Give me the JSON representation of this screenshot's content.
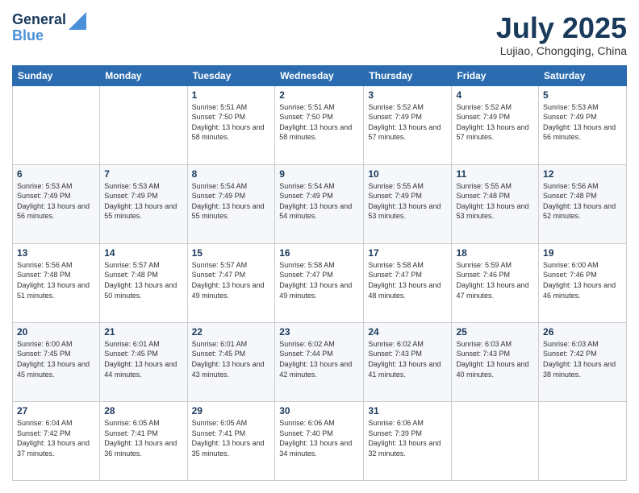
{
  "logo": {
    "general": "General",
    "blue": "Blue"
  },
  "title": {
    "month_year": "July 2025",
    "location": "Lujiao, Chongqing, China"
  },
  "calendar": {
    "headers": [
      "Sunday",
      "Monday",
      "Tuesday",
      "Wednesday",
      "Thursday",
      "Friday",
      "Saturday"
    ],
    "rows": [
      [
        {
          "day": "",
          "info": ""
        },
        {
          "day": "",
          "info": ""
        },
        {
          "day": "1",
          "info": "Sunrise: 5:51 AM\nSunset: 7:50 PM\nDaylight: 13 hours and 58 minutes."
        },
        {
          "day": "2",
          "info": "Sunrise: 5:51 AM\nSunset: 7:50 PM\nDaylight: 13 hours and 58 minutes."
        },
        {
          "day": "3",
          "info": "Sunrise: 5:52 AM\nSunset: 7:49 PM\nDaylight: 13 hours and 57 minutes."
        },
        {
          "day": "4",
          "info": "Sunrise: 5:52 AM\nSunset: 7:49 PM\nDaylight: 13 hours and 57 minutes."
        },
        {
          "day": "5",
          "info": "Sunrise: 5:53 AM\nSunset: 7:49 PM\nDaylight: 13 hours and 56 minutes."
        }
      ],
      [
        {
          "day": "6",
          "info": "Sunrise: 5:53 AM\nSunset: 7:49 PM\nDaylight: 13 hours and 56 minutes."
        },
        {
          "day": "7",
          "info": "Sunrise: 5:53 AM\nSunset: 7:49 PM\nDaylight: 13 hours and 55 minutes."
        },
        {
          "day": "8",
          "info": "Sunrise: 5:54 AM\nSunset: 7:49 PM\nDaylight: 13 hours and 55 minutes."
        },
        {
          "day": "9",
          "info": "Sunrise: 5:54 AM\nSunset: 7:49 PM\nDaylight: 13 hours and 54 minutes."
        },
        {
          "day": "10",
          "info": "Sunrise: 5:55 AM\nSunset: 7:49 PM\nDaylight: 13 hours and 53 minutes."
        },
        {
          "day": "11",
          "info": "Sunrise: 5:55 AM\nSunset: 7:48 PM\nDaylight: 13 hours and 53 minutes."
        },
        {
          "day": "12",
          "info": "Sunrise: 5:56 AM\nSunset: 7:48 PM\nDaylight: 13 hours and 52 minutes."
        }
      ],
      [
        {
          "day": "13",
          "info": "Sunrise: 5:56 AM\nSunset: 7:48 PM\nDaylight: 13 hours and 51 minutes."
        },
        {
          "day": "14",
          "info": "Sunrise: 5:57 AM\nSunset: 7:48 PM\nDaylight: 13 hours and 50 minutes."
        },
        {
          "day": "15",
          "info": "Sunrise: 5:57 AM\nSunset: 7:47 PM\nDaylight: 13 hours and 49 minutes."
        },
        {
          "day": "16",
          "info": "Sunrise: 5:58 AM\nSunset: 7:47 PM\nDaylight: 13 hours and 49 minutes."
        },
        {
          "day": "17",
          "info": "Sunrise: 5:58 AM\nSunset: 7:47 PM\nDaylight: 13 hours and 48 minutes."
        },
        {
          "day": "18",
          "info": "Sunrise: 5:59 AM\nSunset: 7:46 PM\nDaylight: 13 hours and 47 minutes."
        },
        {
          "day": "19",
          "info": "Sunrise: 6:00 AM\nSunset: 7:46 PM\nDaylight: 13 hours and 46 minutes."
        }
      ],
      [
        {
          "day": "20",
          "info": "Sunrise: 6:00 AM\nSunset: 7:45 PM\nDaylight: 13 hours and 45 minutes."
        },
        {
          "day": "21",
          "info": "Sunrise: 6:01 AM\nSunset: 7:45 PM\nDaylight: 13 hours and 44 minutes."
        },
        {
          "day": "22",
          "info": "Sunrise: 6:01 AM\nSunset: 7:45 PM\nDaylight: 13 hours and 43 minutes."
        },
        {
          "day": "23",
          "info": "Sunrise: 6:02 AM\nSunset: 7:44 PM\nDaylight: 13 hours and 42 minutes."
        },
        {
          "day": "24",
          "info": "Sunrise: 6:02 AM\nSunset: 7:43 PM\nDaylight: 13 hours and 41 minutes."
        },
        {
          "day": "25",
          "info": "Sunrise: 6:03 AM\nSunset: 7:43 PM\nDaylight: 13 hours and 40 minutes."
        },
        {
          "day": "26",
          "info": "Sunrise: 6:03 AM\nSunset: 7:42 PM\nDaylight: 13 hours and 38 minutes."
        }
      ],
      [
        {
          "day": "27",
          "info": "Sunrise: 6:04 AM\nSunset: 7:42 PM\nDaylight: 13 hours and 37 minutes."
        },
        {
          "day": "28",
          "info": "Sunrise: 6:05 AM\nSunset: 7:41 PM\nDaylight: 13 hours and 36 minutes."
        },
        {
          "day": "29",
          "info": "Sunrise: 6:05 AM\nSunset: 7:41 PM\nDaylight: 13 hours and 35 minutes."
        },
        {
          "day": "30",
          "info": "Sunrise: 6:06 AM\nSunset: 7:40 PM\nDaylight: 13 hours and 34 minutes."
        },
        {
          "day": "31",
          "info": "Sunrise: 6:06 AM\nSunset: 7:39 PM\nDaylight: 13 hours and 32 minutes."
        },
        {
          "day": "",
          "info": ""
        },
        {
          "day": "",
          "info": ""
        }
      ]
    ]
  }
}
